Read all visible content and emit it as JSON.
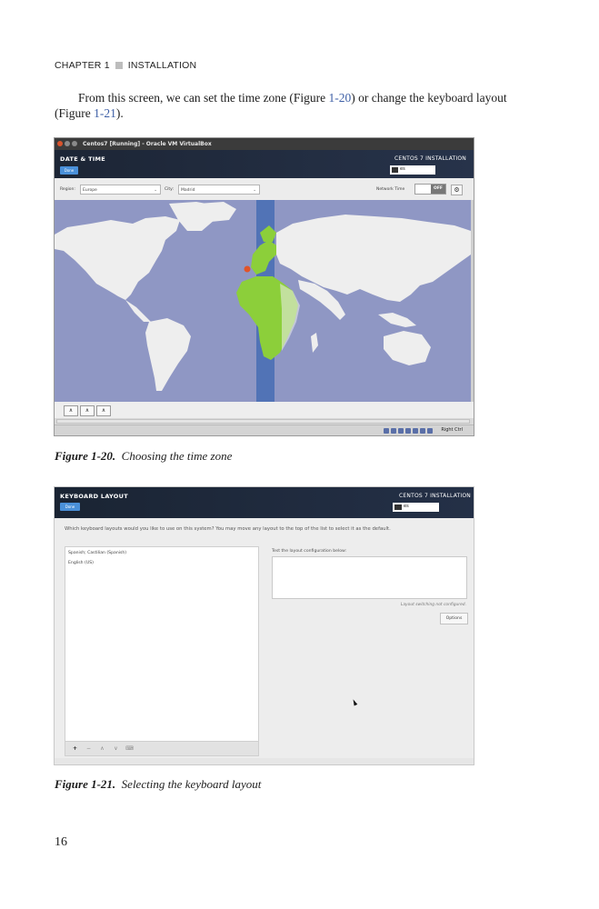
{
  "running_head": {
    "chapter": "CHAPTER 1",
    "section": "INSTALLATION"
  },
  "body_text": {
    "before_ref1": "From this screen, we can set the time zone (Figure ",
    "ref1": "1-20",
    "between": ") or change the keyboard layout (Figure ",
    "ref2": "1-21",
    "after_ref2": ")."
  },
  "figure_1_20": {
    "window_title": "Centos7 [Running] - Oracle VM VirtualBox",
    "screen_title": "DATE & TIME",
    "done_button": "Done",
    "product": "CENTOS 7 INSTALLATION",
    "keyboard_indicator": "es",
    "region_label": "Region:",
    "region_value": "Europe",
    "city_label": "City:",
    "city_value": "Madrid",
    "network_time_label": "Network Time",
    "network_time_state": "OFF",
    "host_key": "Right Ctrl",
    "caption_label": "Figure 1-20.",
    "caption_text": "Choosing the time zone",
    "colors": {
      "ocean": "#8f97c4",
      "land": "#eeeeee",
      "timezone_band": "#4a6fb5",
      "selected": "#8ccf3a",
      "location_pin": "#e0542a"
    }
  },
  "figure_1_21": {
    "screen_title": "KEYBOARD LAYOUT",
    "done_button": "Done",
    "product": "CENTOS 7 INSTALLATION",
    "keyboard_indicator": "es",
    "question": "Which keyboard layouts would you like to use on this system? You may move any layout to the top of the list to select it as the default.",
    "layouts": [
      "Spanish; Castilian (Spanish)",
      "English (US)"
    ],
    "test_label": "Test the layout configuration below:",
    "switching_note": "Layout switching not configured.",
    "options_button": "Options",
    "toolbar": {
      "add": "+",
      "remove": "−",
      "up": "∧",
      "down": "∨",
      "preview": "⌨"
    },
    "caption_label": "Figure 1-21.",
    "caption_text": "Selecting the keyboard layout"
  },
  "page_number": "16"
}
